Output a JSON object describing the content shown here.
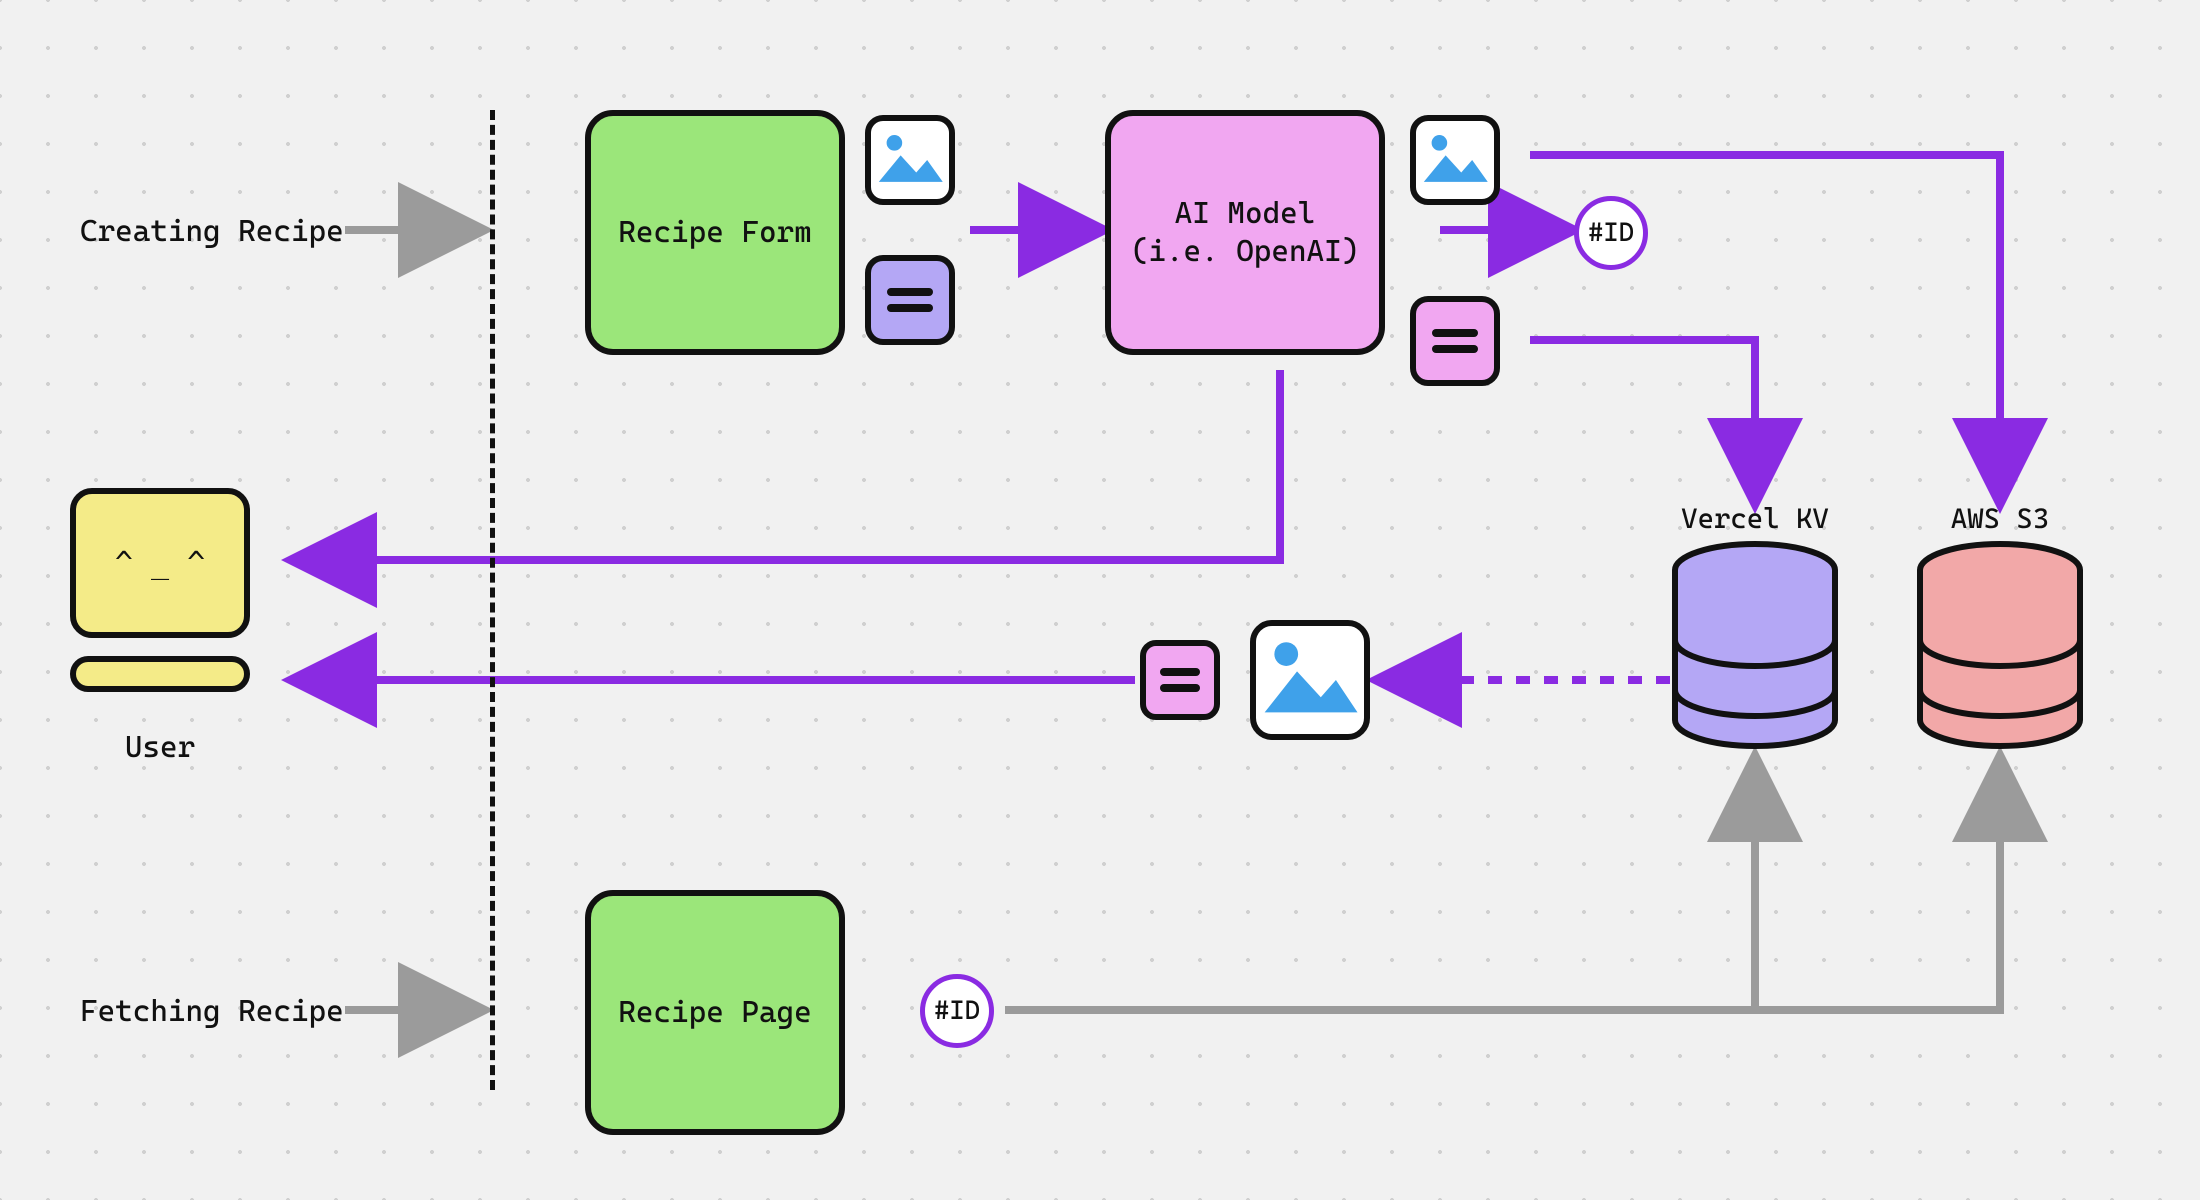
{
  "labels": {
    "creating_recipe": "Creating Recipe",
    "fetching_recipe": "Fetching Recipe",
    "user": "User"
  },
  "nodes": {
    "recipe_form": "Recipe Form",
    "ai_model_line1": "AI Model",
    "ai_model_line2": "(i.e. OpenAI)",
    "recipe_page": "Recipe Page",
    "id_badge_top": "#ID",
    "id_badge_bottom": "#ID",
    "vercel_kv": "Vercel KV",
    "aws_s3": "AWS S3"
  },
  "icons": {
    "image_icon": "image-icon",
    "text_icon": "text-lines-icon",
    "computer_face": "^ _ ^"
  },
  "colors": {
    "purple": "#8A2BE2",
    "gray": "#9b9b9b",
    "green": "#9BE67A",
    "pink": "#F1A7F1",
    "lavender": "#B4A7F5",
    "salmon": "#F2A8A8",
    "yellow": "#F4EB88"
  }
}
